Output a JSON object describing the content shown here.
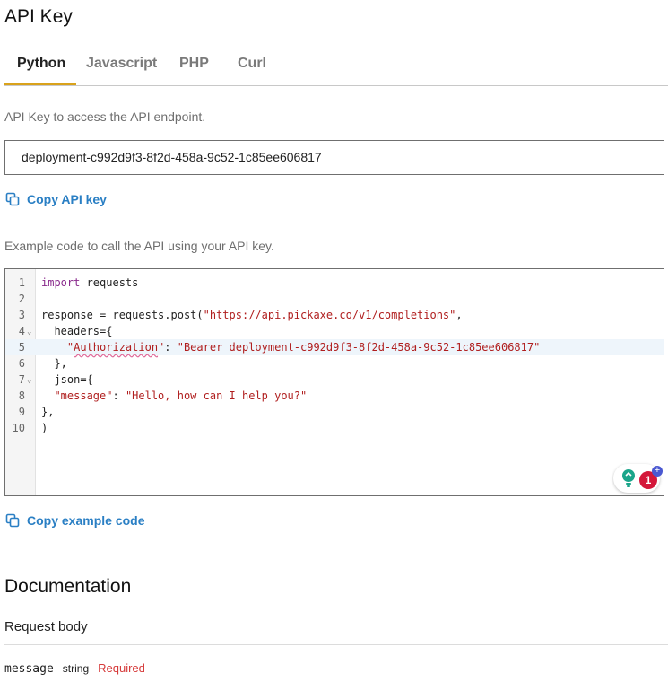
{
  "page": {
    "title": "API Key"
  },
  "tabs": [
    {
      "label": "Python",
      "active": true
    },
    {
      "label": "Javascript",
      "active": false
    },
    {
      "label": "PHP",
      "active": false
    },
    {
      "label": "Curl",
      "active": false
    }
  ],
  "api_key": {
    "hint": "API Key to access the API endpoint.",
    "value": "deployment-c992d9f3-8f2d-458a-9c52-1c85ee606817",
    "copy_label": "Copy API key"
  },
  "example": {
    "hint": "Example code to call the API using your API key.",
    "copy_label": "Copy example code",
    "active_line": 5,
    "lines": [
      {
        "n": "1",
        "tokens": [
          {
            "t": "import",
            "k": "kw"
          },
          {
            "t": " requests",
            "k": ""
          }
        ]
      },
      {
        "n": "2",
        "tokens": []
      },
      {
        "n": "3",
        "tokens": [
          {
            "t": "response = requests.post(",
            "k": ""
          },
          {
            "t": "\"https://api.pickaxe.co/v1/completions\"",
            "k": "str"
          },
          {
            "t": ",",
            "k": ""
          }
        ]
      },
      {
        "n": "4",
        "fold": "⌄",
        "tokens": [
          {
            "t": "  headers={",
            "k": ""
          }
        ]
      },
      {
        "n": "5",
        "tokens": [
          {
            "t": "    \"",
            "k": "str"
          },
          {
            "t": "Authorization",
            "k": "str-under"
          },
          {
            "t": "\"",
            "k": "str"
          },
          {
            "t": ": ",
            "k": ""
          },
          {
            "t": "\"Bearer deployment-c992d9f3-8f2d-458a-9c52-1c85ee606817\"",
            "k": "str"
          }
        ]
      },
      {
        "n": "6",
        "tokens": [
          {
            "t": "  },",
            "k": ""
          }
        ]
      },
      {
        "n": "7",
        "fold": "⌄",
        "tokens": [
          {
            "t": "  json={",
            "k": ""
          }
        ]
      },
      {
        "n": "8",
        "tokens": [
          {
            "t": "  ",
            "k": ""
          },
          {
            "t": "\"message\"",
            "k": "str"
          },
          {
            "t": ": ",
            "k": ""
          },
          {
            "t": "\"Hello, how can I help you?\"",
            "k": "str"
          }
        ]
      },
      {
        "n": "9",
        "tokens": [
          {
            "t": "},",
            "k": ""
          }
        ]
      },
      {
        "n": "10",
        "tokens": [
          {
            "t": ")",
            "k": ""
          }
        ]
      }
    ]
  },
  "assistant_fab": {
    "badge_count": "1",
    "icon": "lightbulb-icon"
  },
  "docs": {
    "title": "Documentation",
    "request_body_label": "Request body",
    "params": [
      {
        "name": "message",
        "type": "string",
        "required": "Required"
      }
    ]
  },
  "colors": {
    "accent": "#d9a21b",
    "link": "#2a7fc4",
    "required": "#d63b3b",
    "badge": "#d4173a"
  }
}
